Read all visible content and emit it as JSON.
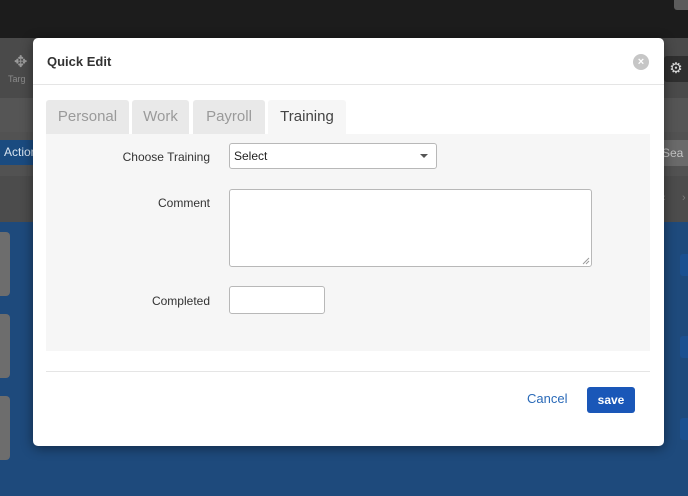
{
  "background": {
    "toolbar_label": "Targ",
    "action_button": "Action",
    "search_stub": "Sea"
  },
  "modal": {
    "title": "Quick Edit",
    "close_icon": "close-icon",
    "tabs": [
      {
        "label": "Personal",
        "active": false
      },
      {
        "label": "Work",
        "active": false
      },
      {
        "label": "Payroll",
        "active": false
      },
      {
        "label": "Training",
        "active": true
      }
    ],
    "fields": {
      "training_label": "Choose Training",
      "training_value": "Select",
      "comment_label": "Comment",
      "comment_value": "",
      "completed_label": "Completed",
      "completed_value": ""
    },
    "footer": {
      "cancel_label": "Cancel",
      "save_label": "save"
    }
  },
  "colors": {
    "accent": "#1a57b8",
    "link": "#2a6ab8",
    "panel_bg": "#f6f6f6",
    "app_blue": "#1e4a7c"
  }
}
